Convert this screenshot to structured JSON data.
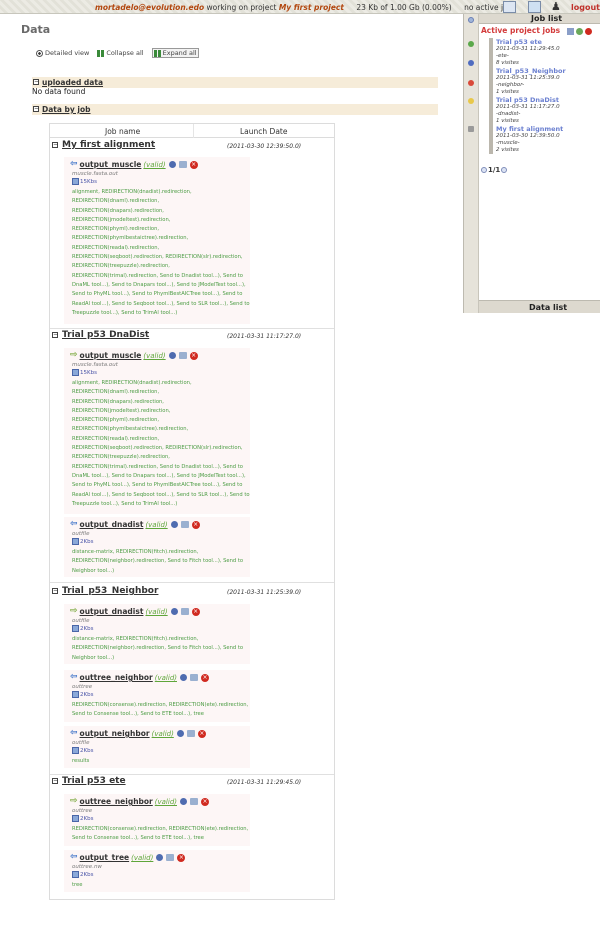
{
  "topbar": {
    "user": "mortadelo@evolution.edo",
    "working_text": "working on project",
    "project": "My first project",
    "usage": "23 Kb of 1.00 Gb (0.00%)",
    "jobs_status": "no active jobs",
    "logout": "logout"
  },
  "page": {
    "title": "Data",
    "view": {
      "detailed": "Detailed view",
      "collapse": "Collapse all",
      "expand": "Expand all"
    },
    "uploaded": {
      "label": "uploaded data",
      "empty": "No data found"
    },
    "by_job": {
      "label": "Data by job"
    }
  },
  "table": {
    "col_job": "Job name",
    "col_date": "Launch Date",
    "jobs": [
      {
        "name": "My first alignment",
        "date": "(2011-03-30 12:39:50.0)",
        "outputs": [
          {
            "name": "output_muscle",
            "status": "(valid)",
            "file": "muscle.fasta.out",
            "size": "15Kbs",
            "links": "alignment, REDIRECTION(dnadist).redirection, REDIRECTION(dnaml).redirection, REDIRECTION(dnapars).redirection, REDIRECTION(jmodeltest).redirection, REDIRECTION(phyml).redirection, REDIRECTION(phymlbestaictree).redirection, REDIRECTION(readal).redirection, REDIRECTION(seqboot).redirection, REDIRECTION(slr).redirection, REDIRECTION(treepuzzle).redirection, REDIRECTION(trimal).redirection, Send to Dnadist tool...), Send to DnaML tool...), Send to Dnapars tool...), Send to JModelTest tool...), Send to PhyML tool...), Send to PhymlBestAICTree tool...), Send to ReadAl tool...), Send to Seqboot tool...), Send to SLR tool...), Send to Treepuzzle tool...), Send to TrimAl tool...)"
          }
        ]
      },
      {
        "name": "Trial p53 DnaDist",
        "date": "(2011-03-31 11:17:27.0)",
        "outputs": [
          {
            "name": "output_muscle",
            "status": "(valid)",
            "file": "muscle.fasta.out",
            "size": "15Kbs",
            "links": "alignment, REDIRECTION(dnadist).redirection, REDIRECTION(dnaml).redirection, REDIRECTION(dnapars).redirection, REDIRECTION(jmodeltest).redirection, REDIRECTION(phyml).redirection, REDIRECTION(phymlbestaictree).redirection, REDIRECTION(readal).redirection, REDIRECTION(seqboot).redirection, REDIRECTION(slr).redirection, REDIRECTION(treepuzzle).redirection, REDIRECTION(trimal).redirection, Send to Dnadist tool...), Send to DnaML tool...), Send to Dnapars tool...), Send to JModelTest tool...), Send to PhyML tool...), Send to PhymlBestAICTree tool...), Send to ReadAl tool...), Send to Seqboot tool...), Send to SLR tool...), Send to Treepuzzle tool...), Send to TrimAl tool...)"
          },
          {
            "name": "output_dnadist",
            "status": "(valid)",
            "file": "outfile",
            "size": "2Kbs",
            "links": "distance-matrix, REDIRECTION(fitch).redirection, REDIRECTION(neighbor).redirection, Send to Fitch tool...), Send to Neighbor tool...)"
          }
        ]
      },
      {
        "name": "Trial_p53_Neighbor",
        "date": "(2011-03-31 11:25:39.0)",
        "outputs": [
          {
            "name": "output_dnadist",
            "status": "(valid)",
            "file": "outfile",
            "size": "2Kbs",
            "links": "distance-matrix, REDIRECTION(fitch).redirection, REDIRECTION(neighbor).redirection, Send to Fitch tool...), Send to Neighbor tool...)"
          },
          {
            "name": "outtree_neighbor",
            "status": "(valid)",
            "file": "outtree",
            "size": "2Kbs",
            "links": "REDIRECTION(consense).redirection, REDIRECTION(ete).redirection, Send to Consense tool...), Send to ETE tool...), tree"
          },
          {
            "name": "output_neighbor",
            "status": "(valid)",
            "file": "outfile",
            "size": "2Kbs",
            "links": "results"
          }
        ]
      },
      {
        "name": "Trial p53 ete",
        "date": "(2011-03-31 11:29:45.0)",
        "outputs": [
          {
            "name": "outtree_neighbor",
            "status": "(valid)",
            "file": "outtree",
            "size": "2Kbs",
            "links": "REDIRECTION(consense).redirection, REDIRECTION(ete).redirection, Send to Consense tool...), Send to ETE tool...), tree"
          },
          {
            "name": "output_tree",
            "status": "(valid)",
            "file": "outtree.nw",
            "size": "2Kbs",
            "links": "tree"
          }
        ]
      }
    ]
  },
  "panel": {
    "title": "Job list",
    "active_label": "Active project jobs",
    "jobs": [
      {
        "name": "Trial p53 ete",
        "date": "2011-03-31 11:29:45.0",
        "method": "-ete-",
        "visits": "8 visites"
      },
      {
        "name": "Trial_p53_Neighbor",
        "date": "2011-03-31 11:25:39.0",
        "method": "-neighbor-",
        "visits": "1 visites"
      },
      {
        "name": "Trial p53 DnaDist",
        "date": "2011-03-31 11:17:27.0",
        "method": "-dnadist-",
        "visits": "1 visites"
      },
      {
        "name": "My first alignment",
        "date": "2011-03-30 12:39:50.0",
        "method": "-muscle-",
        "visits": "2 visites"
      }
    ],
    "pager": "1/1",
    "footer": "Data list"
  }
}
